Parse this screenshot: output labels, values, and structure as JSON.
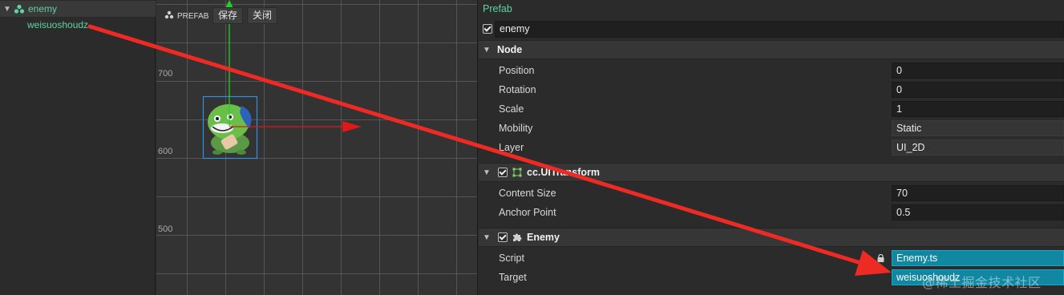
{
  "hierarchy": {
    "root": {
      "label": "enemy",
      "icon": "prefab-node-icon",
      "expanded": true
    },
    "children": [
      {
        "label": "weisuoshoudz"
      }
    ]
  },
  "scene": {
    "prefab_tag": "PREFAB",
    "save_button": "保存",
    "close_button": "关闭",
    "y_labels": [
      "700",
      "600",
      "500"
    ]
  },
  "inspector": {
    "title": "Prefab",
    "node_name": "enemy",
    "node_section": {
      "title": "Node",
      "props": [
        {
          "label": "Position",
          "value": "0"
        },
        {
          "label": "Rotation",
          "value": "0"
        },
        {
          "label": "Scale",
          "value": "1"
        },
        {
          "label": "Mobility",
          "value": "Static"
        },
        {
          "label": "Layer",
          "value": "UI_2D"
        }
      ]
    },
    "transform_section": {
      "title": "cc.UITransform",
      "props": [
        {
          "label": "Content Size",
          "value": "70"
        },
        {
          "label": "Anchor Point",
          "value": "0.5"
        }
      ]
    },
    "enemy_section": {
      "title": "Enemy",
      "props": [
        {
          "label": "Script",
          "value": "Enemy.ts"
        },
        {
          "label": "Target",
          "value": "weisuoshoudz"
        }
      ]
    }
  },
  "watermark": "@稀土掘金技术社区",
  "colors": {
    "accent_green": "#5fd3a3",
    "annotation_red": "#ee2a24",
    "asset_field": "#1287a2"
  }
}
